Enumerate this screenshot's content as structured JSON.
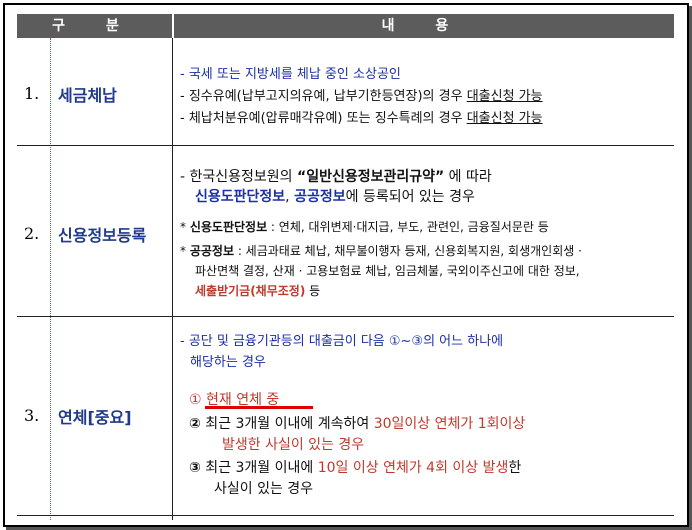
{
  "header": {
    "col1": "구 분",
    "col2": "내 용"
  },
  "rows": [
    {
      "num": "1.",
      "title": "세금체납",
      "lines": [
        {
          "dash": "-",
          "text": "국세 또는 지방세를 체납 중인 소상공인"
        },
        {
          "dash": "-",
          "text": "징수유예(납부고지의유예, 납부기한등연장)의 경우",
          "ul": "대출신청 가능"
        },
        {
          "dash": "-",
          "text": "체납처분유예(압류매각유예) 또는 징수특례의 경우",
          "ul": "대출신청 가능"
        }
      ]
    },
    {
      "num": "2.",
      "title": "신용정보등록",
      "intro_a": "- 한국신용정보원의 ",
      "intro_quote": "“일반신용정보관리규약”",
      "intro_b": " 에 따라",
      "intro2_a": "신용도판단정보",
      "intro2_sep": ", ",
      "intro2_b": "공공정보",
      "intro2_c": "에 등록되어 있는 경우",
      "b1_star": "*",
      "b1_label": "신용도판단정보",
      "b1_text": " : 연체, 대위변제·대지급, 부도, 관련인, 금융질서문란 등",
      "b2_star": "*",
      "b2_label": "공공정보",
      "b2_text": " : 세금과태료 체납, 채무불이행자 등재, 신용회복지원, 회생개인회생 ·",
      "b2_line2": "파산면책 결정, 산재 · 고용보험료 체납, 임금체불, 국외이주신고에 대한 정보,",
      "b2_red": "세출받기금(채무조정)",
      "b2_end": " 등"
    },
    {
      "num": "3.",
      "title": "연체[중요]",
      "intro1": "- 공단 및 금융기관등의 대출금이 다음 ①~③의 어느 하나에",
      "intro2": "해당하는 경우",
      "item1": "① 현재 연체 중",
      "item2_mark": "②",
      "item2_a": " 최근 3개월 이내에 계속하여 ",
      "item2_red": "30일이상 연체가 1회이상",
      "item2_line2": "발생한 사실이 있는 경우",
      "item3_mark": "③",
      "item3_a": " 최근 3개월 이내에 ",
      "item3_red": "10일 이상 연체가 4회 이상 발생",
      "item3_b": "한",
      "item3_line2": "사실이 있는 경우"
    }
  ]
}
